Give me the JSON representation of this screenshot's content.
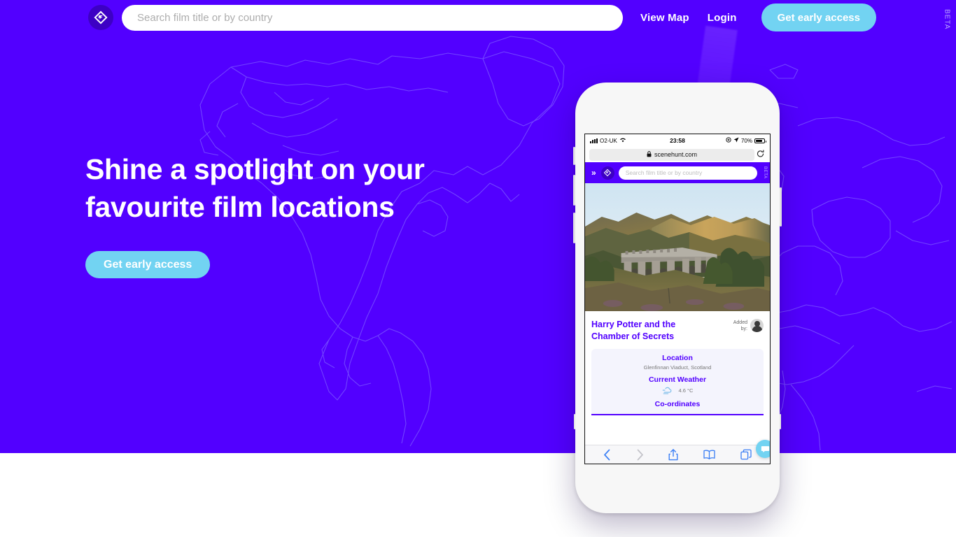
{
  "brand": {
    "accent_purple": "#5200ff",
    "accent_cyan": "#72d3f2",
    "logo_name": "scenehunt-logo"
  },
  "nav": {
    "logo_icon": "scenehunt-logo-icon",
    "search": {
      "placeholder": "Search film title or by country",
      "value": ""
    },
    "links": [
      {
        "label": "View Map",
        "name": "nav-link-view-map"
      },
      {
        "label": "Login",
        "name": "nav-link-login"
      }
    ],
    "cta_label": "Get early access",
    "beta_label": "BETA"
  },
  "hero": {
    "title_line1": "Shine a spotlight on your",
    "title_line2": "favourite film locations",
    "cta_label": "Get early access"
  },
  "phone": {
    "status_bar": {
      "carrier": "O2-UK",
      "time": "23:58",
      "battery_percent": "70%",
      "wifi_icon": "wifi-icon",
      "signal_icon": "signal-bars-icon",
      "location_icon": "location-arrow-icon",
      "lock_rotation_icon": "rotation-lock-icon"
    },
    "browser": {
      "lock_icon": "lock-icon",
      "url": "scenehunt.com",
      "reload_icon": "reload-icon",
      "toolbar": [
        {
          "name": "back-button",
          "icon": "chevron-left-icon"
        },
        {
          "name": "forward-button",
          "icon": "chevron-right-icon"
        },
        {
          "name": "share-button",
          "icon": "share-icon"
        },
        {
          "name": "bookmarks-button",
          "icon": "book-icon"
        },
        {
          "name": "tabs-button",
          "icon": "tabs-icon"
        }
      ]
    },
    "app_header": {
      "menu_icon": "double-chevron-right-icon",
      "logo_icon": "scenehunt-logo-icon",
      "search_placeholder": "Search film title or by country",
      "beta_label": "BETA"
    },
    "photo_alt": "glenfinnan-viaduct-photo",
    "film": {
      "title": "Harry Potter and the Chamber of Secrets",
      "added_by_label": "Added by:",
      "avatar_icon": "user-avatar"
    },
    "info": {
      "location_heading": "Location",
      "location_value": "Glenfinnan Viaduct, Scotland",
      "weather_heading": "Current Weather",
      "weather_icon": "windy-weather-icon",
      "temperature": "4.6 °C",
      "coordinates_heading": "Co-ordinates"
    },
    "chat_icon": "chat-bubble-icon"
  }
}
